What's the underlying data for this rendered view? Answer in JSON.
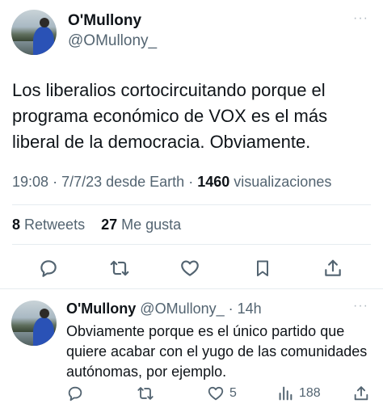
{
  "main_tweet": {
    "display_name": "O'Mullony",
    "handle": "@OMullony_",
    "more": "···",
    "text": "Los liberalios cortocircuitando porque el programa económico de VOX es el más liberal de la democracia. Obviamente.",
    "time": "19:08",
    "date": "7/7/23",
    "source": "desde Earth",
    "views_count": "1460",
    "views_label": "visualizaciones",
    "retweets_count": "8",
    "retweets_label": "Retweets",
    "likes_count": "27",
    "likes_label": "Me gusta"
  },
  "reply_tweet": {
    "display_name": "O'Mullony",
    "handle": "@OMullony_",
    "age": "14h",
    "more": "···",
    "text": "Obviamente porque es el único partido que quiere acabar con el yugo de las comunidades autónomas, por ejemplo.",
    "likes": "5",
    "views": "188"
  },
  "icons": {
    "reply": "comment-icon",
    "retweet": "retweet-icon",
    "like": "heart-icon",
    "bookmark": "bookmark-icon",
    "share": "share-icon",
    "views": "views-chart-icon"
  },
  "colors": {
    "text": "#0f1419",
    "secondary": "#536471",
    "divider": "#e6ecf0",
    "avatar_shirt": "#2a52b6"
  }
}
